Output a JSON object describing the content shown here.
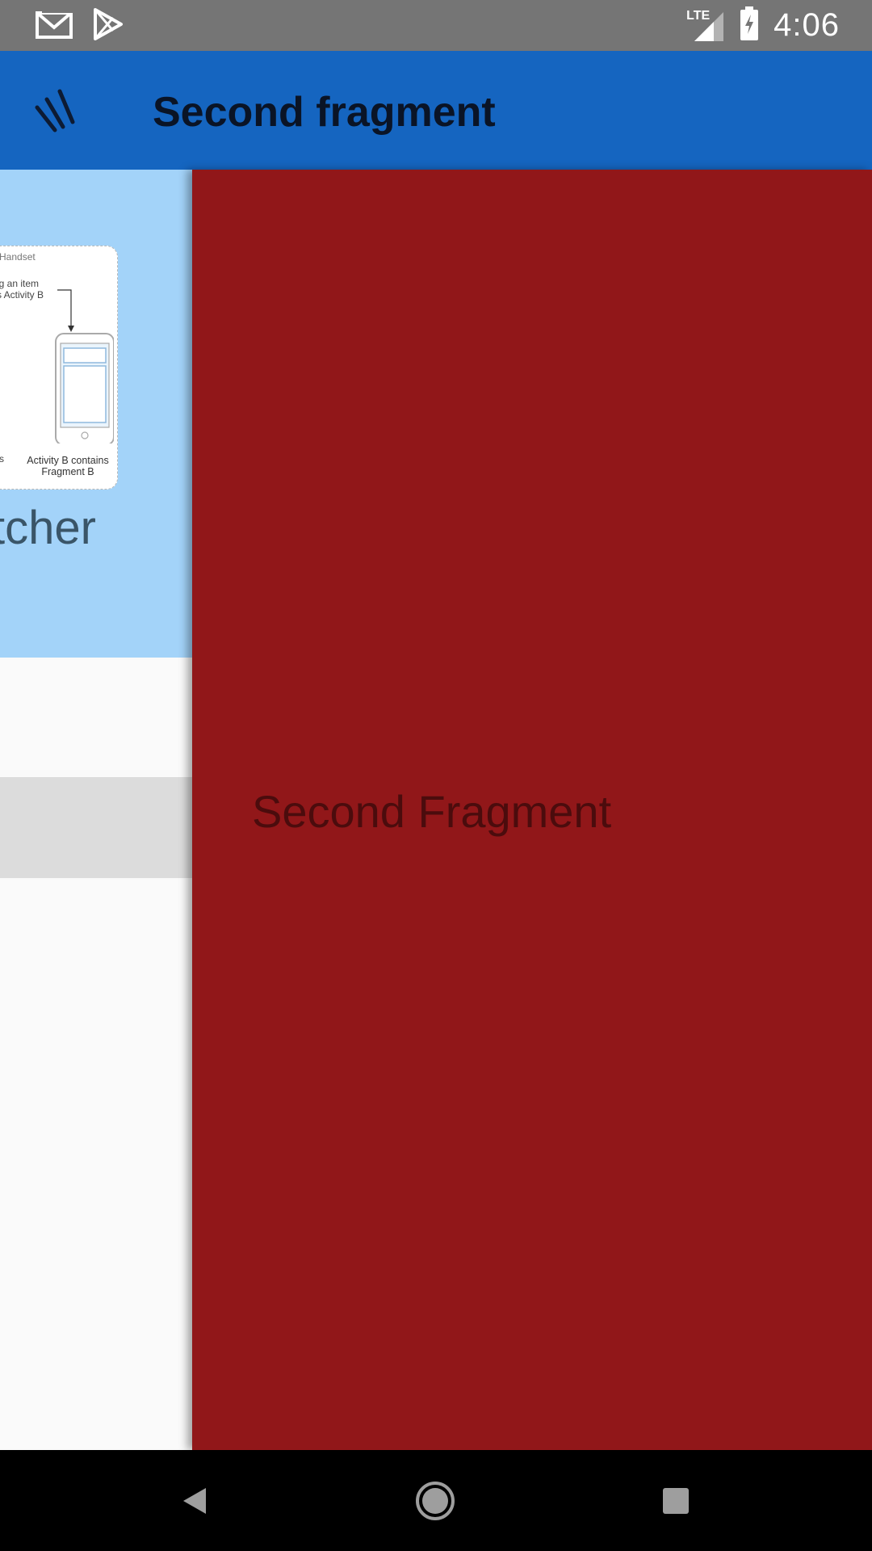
{
  "status_bar": {
    "time": "4:06",
    "network": "LTE",
    "icons": [
      "gmail-icon",
      "play-store-icon",
      "lte-signal-icon",
      "battery-charging-icon"
    ]
  },
  "app_bar": {
    "title": "Second fragment",
    "background": "#1565c0",
    "nav_icon": "drawer-menu-icon"
  },
  "left_panel": {
    "illustration": {
      "device_label": "Handset",
      "selecting_line1": "ting an item",
      "selecting_line2": "s Activity B",
      "left_cut_caption": "s",
      "caption_line1": "Activity B contains",
      "caption_line2": "Fragment B"
    },
    "hero_text": "tcher",
    "hero_background": "#a3d3f9"
  },
  "fragment": {
    "text": "Second Fragment",
    "background": "#911719"
  },
  "nav_bar": {
    "buttons": [
      "back-icon",
      "home-icon",
      "recents-icon"
    ]
  }
}
